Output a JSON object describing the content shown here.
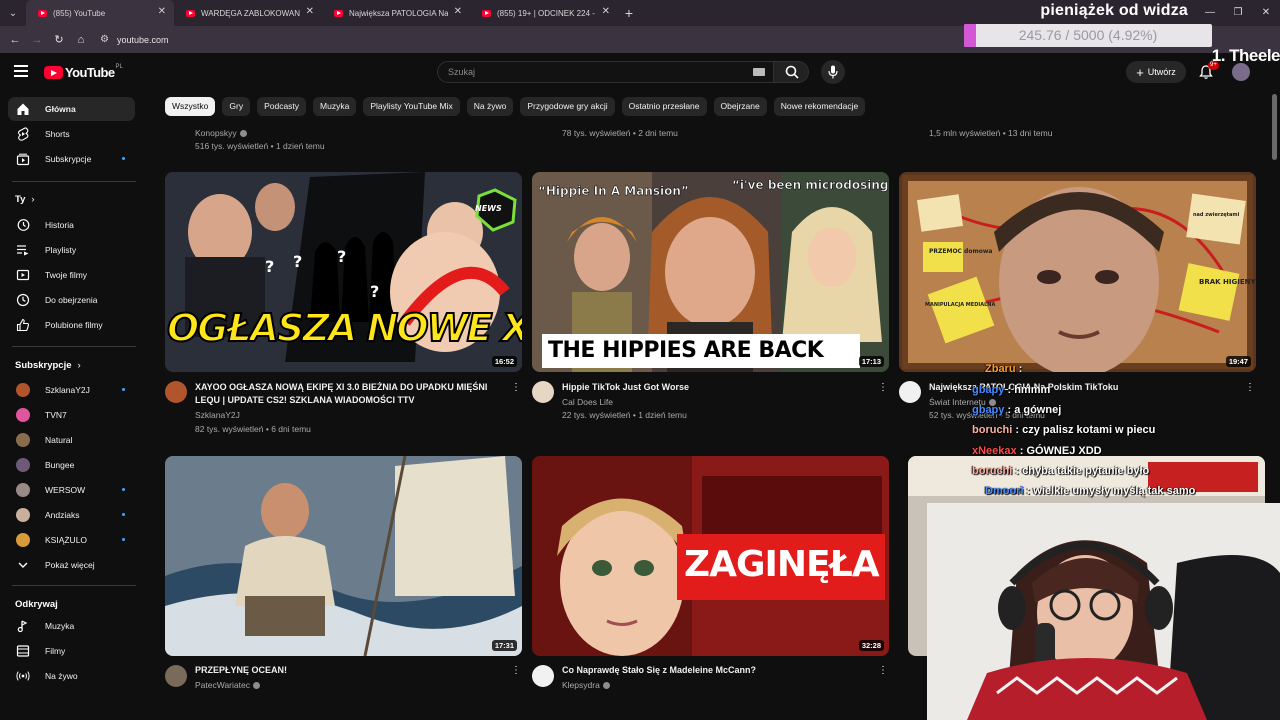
{
  "browser": {
    "tabs": [
      {
        "title": "(855) YouTube",
        "active": true
      },
      {
        "title": "WARDĘGA ZABLOKOWANY NA...",
        "active": false
      },
      {
        "title": "Największa PATOLOGIA Na Pols...",
        "active": false
      },
      {
        "title": "(855) 19+ | ODCINEK 224 - You...",
        "active": false
      }
    ],
    "url": "youtube.com"
  },
  "donation_overlay": {
    "title": "pieniążek od widza",
    "progress_text": "245.76 / 5000 (4.92%)",
    "progress_fraction": 0.0492,
    "overlay_brand": "1. Theele"
  },
  "masthead": {
    "logo": "YouTube",
    "country": "PL",
    "search_placeholder": "Szukaj",
    "create_label": "Utwórz",
    "notifications_badge": "9+"
  },
  "sidebar": {
    "main": [
      {
        "label": "Główna",
        "icon": "home-icon",
        "active": true
      },
      {
        "label": "Shorts",
        "icon": "shorts-icon"
      },
      {
        "label": "Subskrypcje",
        "icon": "subscriptions-icon",
        "dot": true
      }
    ],
    "you_header": "Ty",
    "you": [
      {
        "label": "Historia",
        "icon": "history-icon"
      },
      {
        "label": "Playlisty",
        "icon": "playlist-icon"
      },
      {
        "label": "Twoje filmy",
        "icon": "your-videos-icon"
      },
      {
        "label": "Do obejrzenia",
        "icon": "watch-later-icon"
      },
      {
        "label": "Polubione filmy",
        "icon": "like-icon"
      }
    ],
    "subs_header": "Subskrypcje",
    "subs": [
      {
        "label": "SzklanaY2J",
        "color": "#b0552c",
        "dot": true
      },
      {
        "label": "TVN7",
        "color": "#e0559c",
        "dot": false
      },
      {
        "label": "Natural",
        "color": "#8a6b4e",
        "dot": false
      },
      {
        "label": "Bungee",
        "color": "#6c5a78",
        "dot": false
      },
      {
        "label": "WERSOW",
        "color": "#9a8a86",
        "dot": true
      },
      {
        "label": "Andziaks",
        "color": "#c9b09a",
        "dot": true
      },
      {
        "label": "KSIĄŻULO",
        "color": "#d99a3a",
        "dot": true
      }
    ],
    "show_more": "Pokaż więcej",
    "explore_header": "Odkrywaj",
    "explore": [
      {
        "label": "Muzyka",
        "icon": "music-icon"
      },
      {
        "label": "Filmy",
        "icon": "film-icon"
      },
      {
        "label": "Na żywo",
        "icon": "live-icon"
      }
    ]
  },
  "chips": [
    "Wszystko",
    "Gry",
    "Podcasty",
    "Muzyka",
    "Playlisty YouTube Mix",
    "Na żywo",
    "Przygodowe gry akcji",
    "Ostatnio przesłane",
    "Obejrzane",
    "Nowe rekomendacje"
  ],
  "prev_row": {
    "col1_channel": "Konopskyy",
    "col1_stats": "516 tys. wyświetleń • 1 dzień temu",
    "col2_stats": "78 tys. wyświetleń • 2 dni temu",
    "col3_stats": "1,5 mln wyświetleń • 13 dni temu"
  },
  "videos": [
    {
      "title": "XAYOO OGŁASZA NOWĄ EKIPĘ XI 3.0  BIEŻNIA DO UPADKU MIĘŚNI LEQU | UPDATE CS2! SZKLANA WIADOMOŚCI TTV",
      "channel": "SzklanaY2J",
      "stats": "82 tys. wyświetleń • 6 dni temu",
      "duration": "16:52",
      "thumb_text": "OGŁASZA NOWE XI!",
      "badge": "NEWS"
    },
    {
      "title": "Hippie TikTok Just Got Worse",
      "channel": "Cal Does Life",
      "stats": "22 tys. wyświetleń • 1 dzień temu",
      "duration": "17:13",
      "thumb_text": "THE HIPPIES ARE BACK",
      "quote1": "“Hippie In A Mansion”",
      "quote2": "“i've been microdosing”"
    },
    {
      "title": "Największa PATOLOGIA Na Polskim TikToku",
      "channel": "Świat Internetu",
      "stats": "52 tys. wyświetleń • 5 dni temu",
      "duration": "19:47",
      "notes": [
        "PRZEMOC domowa",
        "BRAK HIGIENY",
        "MANIPULACJA MEDIALNA",
        "nad zwierzętami"
      ]
    },
    {
      "title": "PRZEPŁYNĘ OCEAN!",
      "channel": "PatecWariatec",
      "duration": "17:31"
    },
    {
      "title": "Co Naprawdę Stało Się z Madeleine McCann?",
      "channel": "Klepsydra",
      "duration": "32:28",
      "thumb_text": "ZAGINĘŁA"
    }
  ],
  "chat": [
    {
      "user": "Zbaru",
      "msg": "",
      "color": "#ff9b2f"
    },
    {
      "user": "gbapy",
      "msg": "hmmm",
      "color": "#4b8bff"
    },
    {
      "user": "gbapy",
      "msg": "a gównej",
      "color": "#4b8bff"
    },
    {
      "user": "boruchi",
      "msg": "czy palisz kotami w piecu",
      "color": "#ffb0a0"
    },
    {
      "user": "xNeekax",
      "msg": "GÓWNEJ XDD",
      "color": "#ff4a4a"
    },
    {
      "user": "boruchi",
      "msg": "chyba takie pytanie było",
      "color": "#ffb0a0"
    },
    {
      "user": "Dmoori",
      "msg": "wielkie umysły myślą tak samo",
      "color": "#4b8bff"
    }
  ]
}
